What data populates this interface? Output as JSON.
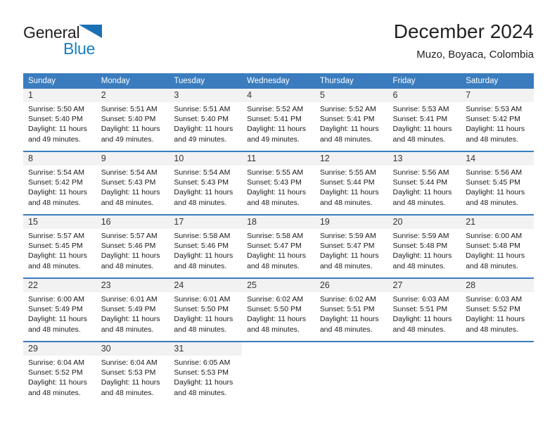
{
  "brand": {
    "name_dark": "General",
    "name_blue": "Blue",
    "triangle_color": "#1a6fb5"
  },
  "header": {
    "title": "December 2024",
    "subtitle": "Muzo, Boyaca, Colombia",
    "accent_color": "#3a7cbe"
  },
  "weekdays": [
    "Sunday",
    "Monday",
    "Tuesday",
    "Wednesday",
    "Thursday",
    "Friday",
    "Saturday"
  ],
  "weeks": [
    [
      {
        "day": "1",
        "sunrise": "Sunrise: 5:50 AM",
        "sunset": "Sunset: 5:40 PM",
        "daylight_1": "Daylight: 11 hours",
        "daylight_2": "and 49 minutes."
      },
      {
        "day": "2",
        "sunrise": "Sunrise: 5:51 AM",
        "sunset": "Sunset: 5:40 PM",
        "daylight_1": "Daylight: 11 hours",
        "daylight_2": "and 49 minutes."
      },
      {
        "day": "3",
        "sunrise": "Sunrise: 5:51 AM",
        "sunset": "Sunset: 5:40 PM",
        "daylight_1": "Daylight: 11 hours",
        "daylight_2": "and 49 minutes."
      },
      {
        "day": "4",
        "sunrise": "Sunrise: 5:52 AM",
        "sunset": "Sunset: 5:41 PM",
        "daylight_1": "Daylight: 11 hours",
        "daylight_2": "and 49 minutes."
      },
      {
        "day": "5",
        "sunrise": "Sunrise: 5:52 AM",
        "sunset": "Sunset: 5:41 PM",
        "daylight_1": "Daylight: 11 hours",
        "daylight_2": "and 48 minutes."
      },
      {
        "day": "6",
        "sunrise": "Sunrise: 5:53 AM",
        "sunset": "Sunset: 5:41 PM",
        "daylight_1": "Daylight: 11 hours",
        "daylight_2": "and 48 minutes."
      },
      {
        "day": "7",
        "sunrise": "Sunrise: 5:53 AM",
        "sunset": "Sunset: 5:42 PM",
        "daylight_1": "Daylight: 11 hours",
        "daylight_2": "and 48 minutes."
      }
    ],
    [
      {
        "day": "8",
        "sunrise": "Sunrise: 5:54 AM",
        "sunset": "Sunset: 5:42 PM",
        "daylight_1": "Daylight: 11 hours",
        "daylight_2": "and 48 minutes."
      },
      {
        "day": "9",
        "sunrise": "Sunrise: 5:54 AM",
        "sunset": "Sunset: 5:43 PM",
        "daylight_1": "Daylight: 11 hours",
        "daylight_2": "and 48 minutes."
      },
      {
        "day": "10",
        "sunrise": "Sunrise: 5:54 AM",
        "sunset": "Sunset: 5:43 PM",
        "daylight_1": "Daylight: 11 hours",
        "daylight_2": "and 48 minutes."
      },
      {
        "day": "11",
        "sunrise": "Sunrise: 5:55 AM",
        "sunset": "Sunset: 5:43 PM",
        "daylight_1": "Daylight: 11 hours",
        "daylight_2": "and 48 minutes."
      },
      {
        "day": "12",
        "sunrise": "Sunrise: 5:55 AM",
        "sunset": "Sunset: 5:44 PM",
        "daylight_1": "Daylight: 11 hours",
        "daylight_2": "and 48 minutes."
      },
      {
        "day": "13",
        "sunrise": "Sunrise: 5:56 AM",
        "sunset": "Sunset: 5:44 PM",
        "daylight_1": "Daylight: 11 hours",
        "daylight_2": "and 48 minutes."
      },
      {
        "day": "14",
        "sunrise": "Sunrise: 5:56 AM",
        "sunset": "Sunset: 5:45 PM",
        "daylight_1": "Daylight: 11 hours",
        "daylight_2": "and 48 minutes."
      }
    ],
    [
      {
        "day": "15",
        "sunrise": "Sunrise: 5:57 AM",
        "sunset": "Sunset: 5:45 PM",
        "daylight_1": "Daylight: 11 hours",
        "daylight_2": "and 48 minutes."
      },
      {
        "day": "16",
        "sunrise": "Sunrise: 5:57 AM",
        "sunset": "Sunset: 5:46 PM",
        "daylight_1": "Daylight: 11 hours",
        "daylight_2": "and 48 minutes."
      },
      {
        "day": "17",
        "sunrise": "Sunrise: 5:58 AM",
        "sunset": "Sunset: 5:46 PM",
        "daylight_1": "Daylight: 11 hours",
        "daylight_2": "and 48 minutes."
      },
      {
        "day": "18",
        "sunrise": "Sunrise: 5:58 AM",
        "sunset": "Sunset: 5:47 PM",
        "daylight_1": "Daylight: 11 hours",
        "daylight_2": "and 48 minutes."
      },
      {
        "day": "19",
        "sunrise": "Sunrise: 5:59 AM",
        "sunset": "Sunset: 5:47 PM",
        "daylight_1": "Daylight: 11 hours",
        "daylight_2": "and 48 minutes."
      },
      {
        "day": "20",
        "sunrise": "Sunrise: 5:59 AM",
        "sunset": "Sunset: 5:48 PM",
        "daylight_1": "Daylight: 11 hours",
        "daylight_2": "and 48 minutes."
      },
      {
        "day": "21",
        "sunrise": "Sunrise: 6:00 AM",
        "sunset": "Sunset: 5:48 PM",
        "daylight_1": "Daylight: 11 hours",
        "daylight_2": "and 48 minutes."
      }
    ],
    [
      {
        "day": "22",
        "sunrise": "Sunrise: 6:00 AM",
        "sunset": "Sunset: 5:49 PM",
        "daylight_1": "Daylight: 11 hours",
        "daylight_2": "and 48 minutes."
      },
      {
        "day": "23",
        "sunrise": "Sunrise: 6:01 AM",
        "sunset": "Sunset: 5:49 PM",
        "daylight_1": "Daylight: 11 hours",
        "daylight_2": "and 48 minutes."
      },
      {
        "day": "24",
        "sunrise": "Sunrise: 6:01 AM",
        "sunset": "Sunset: 5:50 PM",
        "daylight_1": "Daylight: 11 hours",
        "daylight_2": "and 48 minutes."
      },
      {
        "day": "25",
        "sunrise": "Sunrise: 6:02 AM",
        "sunset": "Sunset: 5:50 PM",
        "daylight_1": "Daylight: 11 hours",
        "daylight_2": "and 48 minutes."
      },
      {
        "day": "26",
        "sunrise": "Sunrise: 6:02 AM",
        "sunset": "Sunset: 5:51 PM",
        "daylight_1": "Daylight: 11 hours",
        "daylight_2": "and 48 minutes."
      },
      {
        "day": "27",
        "sunrise": "Sunrise: 6:03 AM",
        "sunset": "Sunset: 5:51 PM",
        "daylight_1": "Daylight: 11 hours",
        "daylight_2": "and 48 minutes."
      },
      {
        "day": "28",
        "sunrise": "Sunrise: 6:03 AM",
        "sunset": "Sunset: 5:52 PM",
        "daylight_1": "Daylight: 11 hours",
        "daylight_2": "and 48 minutes."
      }
    ],
    [
      {
        "day": "29",
        "sunrise": "Sunrise: 6:04 AM",
        "sunset": "Sunset: 5:52 PM",
        "daylight_1": "Daylight: 11 hours",
        "daylight_2": "and 48 minutes."
      },
      {
        "day": "30",
        "sunrise": "Sunrise: 6:04 AM",
        "sunset": "Sunset: 5:53 PM",
        "daylight_1": "Daylight: 11 hours",
        "daylight_2": "and 48 minutes."
      },
      {
        "day": "31",
        "sunrise": "Sunrise: 6:05 AM",
        "sunset": "Sunset: 5:53 PM",
        "daylight_1": "Daylight: 11 hours",
        "daylight_2": "and 48 minutes."
      },
      {
        "day": "",
        "sunrise": "",
        "sunset": "",
        "daylight_1": "",
        "daylight_2": ""
      },
      {
        "day": "",
        "sunrise": "",
        "sunset": "",
        "daylight_1": "",
        "daylight_2": ""
      },
      {
        "day": "",
        "sunrise": "",
        "sunset": "",
        "daylight_1": "",
        "daylight_2": ""
      },
      {
        "day": "",
        "sunrise": "",
        "sunset": "",
        "daylight_1": "",
        "daylight_2": ""
      }
    ]
  ]
}
